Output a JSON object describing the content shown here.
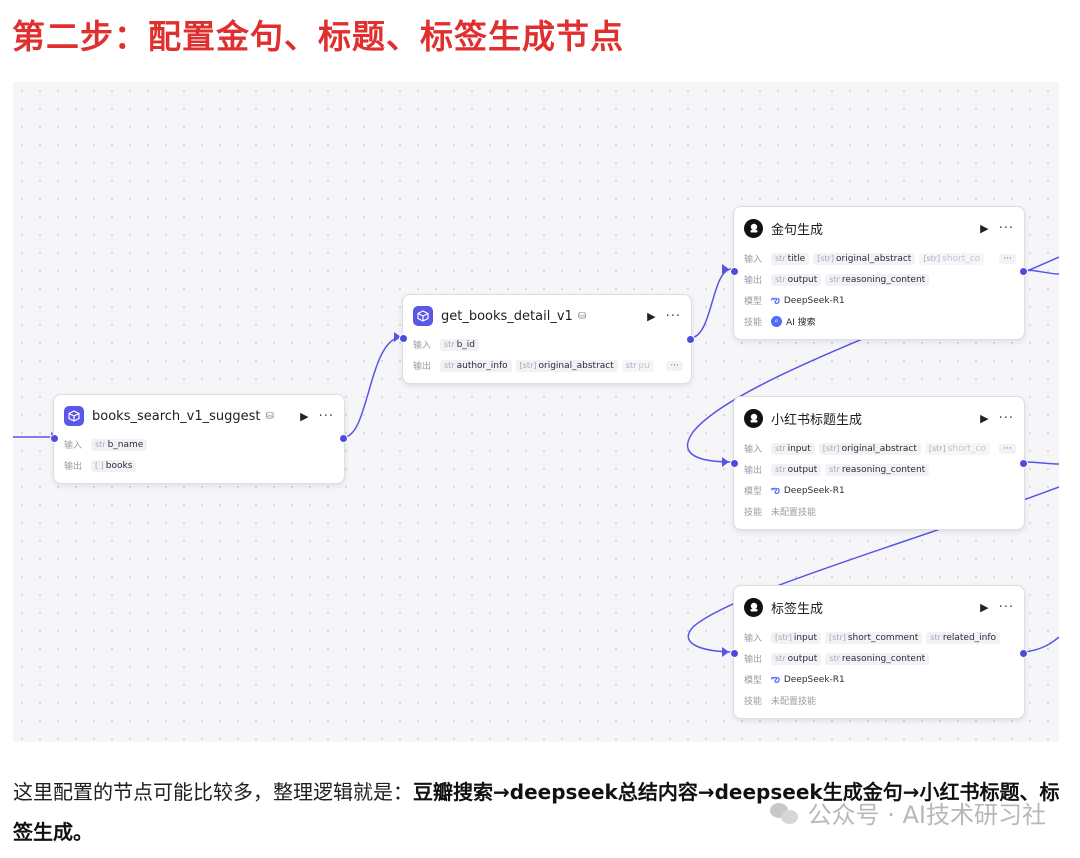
{
  "heading": "第二步：配置金句、标题、标签生成节点",
  "labels": {
    "input": "输入",
    "output": "输出",
    "model": "模型",
    "skill": "技能"
  },
  "nodes": {
    "books_search": {
      "title": "books_search_v1_suggest",
      "inputs": [
        {
          "type": "str",
          "name": "b_name"
        }
      ],
      "outputs": [
        {
          "type": "[ ]",
          "name": "books"
        }
      ]
    },
    "get_books_detail": {
      "title": "get_books_detail_v1",
      "inputs": [
        {
          "type": "str",
          "name": "b_id"
        }
      ],
      "outputs": [
        {
          "type": "str",
          "name": "author_info"
        },
        {
          "type": "[str]",
          "name": "original_abstract"
        },
        {
          "type": "str",
          "name": "pu"
        }
      ]
    },
    "golden_sentence": {
      "title": "金句生成",
      "inputs": [
        {
          "type": "str",
          "name": "title"
        },
        {
          "type": "[str]",
          "name": "original_abstract"
        },
        {
          "type": "[str]",
          "name": "short_co"
        }
      ],
      "outputs": [
        {
          "type": "str",
          "name": "output"
        },
        {
          "type": "str",
          "name": "reasoning_content"
        }
      ],
      "model": "DeepSeek-R1",
      "skill": "AI 搜索"
    },
    "xhs_title": {
      "title": "小红书标题生成",
      "inputs": [
        {
          "type": "str",
          "name": "input"
        },
        {
          "type": "[str]",
          "name": "original_abstract"
        },
        {
          "type": "[str]",
          "name": "short_co"
        }
      ],
      "outputs": [
        {
          "type": "str",
          "name": "output"
        },
        {
          "type": "str",
          "name": "reasoning_content"
        }
      ],
      "model": "DeepSeek-R1",
      "skill": "未配置技能"
    },
    "tag": {
      "title": "标签生成",
      "inputs": [
        {
          "type": "[str]",
          "name": "input"
        },
        {
          "type": "[str]",
          "name": "short_comment"
        },
        {
          "type": "str",
          "name": "related_info"
        }
      ],
      "outputs": [
        {
          "type": "str",
          "name": "output"
        },
        {
          "type": "str",
          "name": "reasoning_content"
        }
      ],
      "model": "DeepSeek-R1",
      "skill": "未配置技能"
    }
  },
  "paragraph": {
    "intro": "这里配置的节点可能比较多，整理逻辑就是：",
    "bold": "豆瓣搜索→deepseek总结内容→deepseek生成金句→小红书标题、标签生成。"
  },
  "watermark": "公众号 · AI技术研习社",
  "colors": {
    "heading": "#e02f2f",
    "edge": "#5855e6",
    "plugin_icon": "#5b57e8"
  }
}
